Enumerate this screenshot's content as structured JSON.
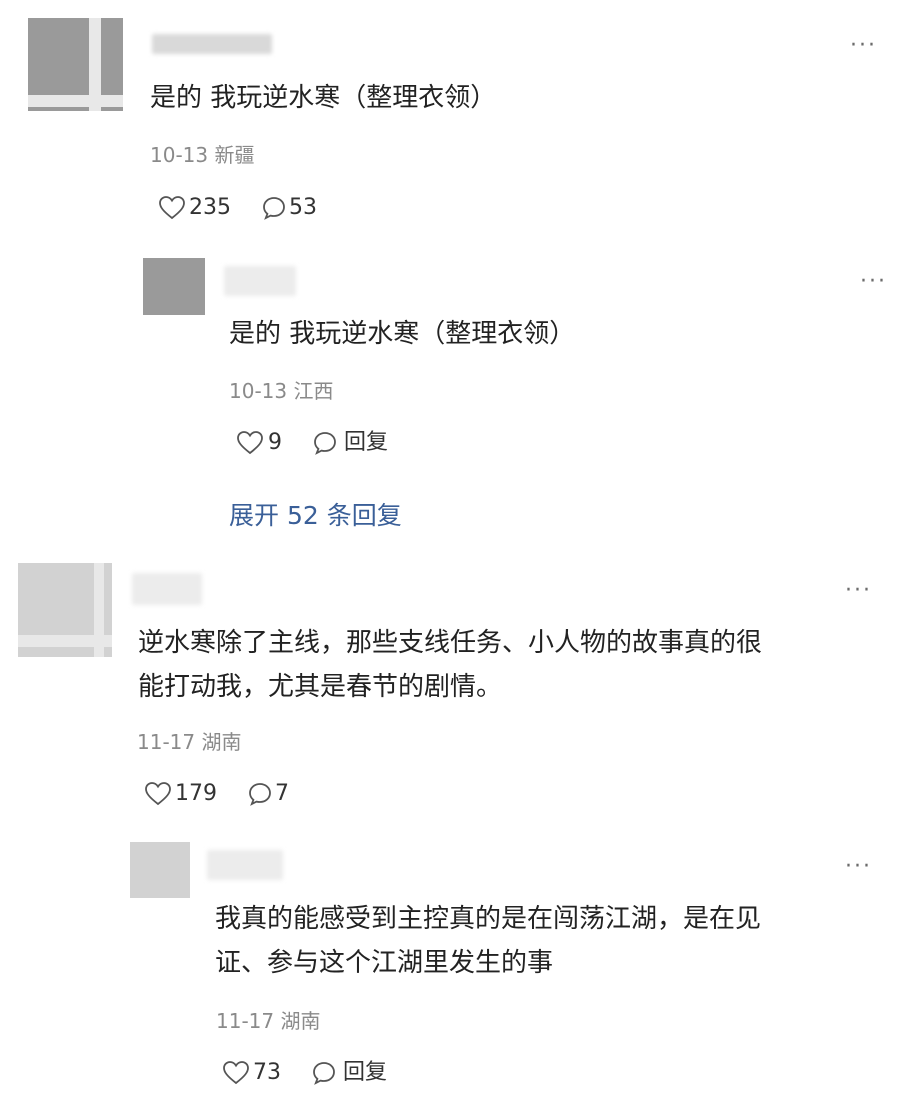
{
  "comments": [
    {
      "content": "是的 我玩逆水寒（整理衣领）",
      "date": "10-13",
      "region": "新疆",
      "likes": "235",
      "replies": "53",
      "more": "···",
      "reply": {
        "content": "是的 我玩逆水寒（整理衣领）",
        "date": "10-13",
        "region": "江西",
        "likes": "9",
        "reply_label": "回复",
        "more": "···"
      },
      "expand_label": "展开 52 条回复"
    },
    {
      "content_line1": "逆水寒除了主线，那些支线任务、小人物的故事真的很",
      "content_line2": "能打动我，尤其是春节的剧情。",
      "date": "11-17",
      "region": "湖南",
      "likes": "179",
      "replies": "7",
      "more": "···",
      "reply": {
        "content_line1": "我真的能感受到主控真的是在闯荡江湖，是在见",
        "content_line2": "证、参与这个江湖里发生的事",
        "date": "11-17",
        "region": "湖南",
        "likes": "73",
        "reply_label": "回复",
        "more": "···"
      }
    }
  ],
  "icons": {
    "like": "heart-outline-icon",
    "comment": "speech-bubble-icon",
    "more": "more-dots-icon"
  }
}
